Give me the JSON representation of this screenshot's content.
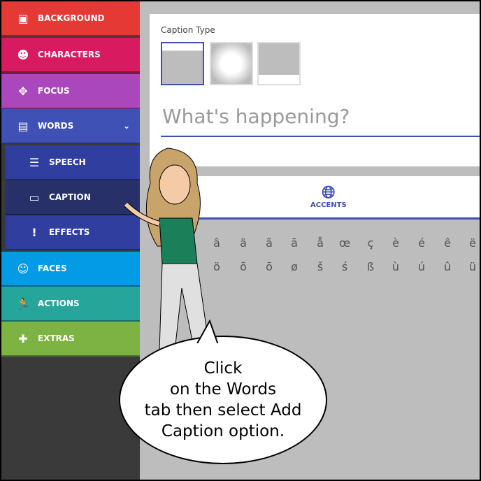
{
  "sidebar": {
    "items": [
      {
        "label": "BACKGROUND",
        "icon": "image-icon",
        "color": "#e53935"
      },
      {
        "label": "CHARACTERS",
        "icon": "face-icon",
        "color": "#d81b60"
      },
      {
        "label": "FOCUS",
        "icon": "move-icon",
        "color": "#ab47bc"
      },
      {
        "label": "WORDS",
        "icon": "message-icon",
        "color": "#3f51b5"
      },
      {
        "label": "SPEECH",
        "icon": "list-icon",
        "color": "#303f9f"
      },
      {
        "label": "CAPTION",
        "icon": "window-icon",
        "color": "#283069"
      },
      {
        "label": "EFFECTS",
        "icon": "exclamation-icon",
        "color": "#303f9f"
      },
      {
        "label": "FACES",
        "icon": "smile-icon",
        "color": "#039be5"
      },
      {
        "label": "ACTIONS",
        "icon": "run-icon",
        "color": "#26a69a"
      },
      {
        "label": "EXTRAS",
        "icon": "puzzle-icon",
        "color": "#7cb342"
      }
    ]
  },
  "caption_panel": {
    "title": "Caption Type",
    "placeholder": "What's happening?"
  },
  "tabs": {
    "accents": "ACCENTS"
  },
  "accents": {
    "row1": [
      "â",
      "ä",
      "ã",
      "ā",
      "å",
      "œ",
      "ç",
      "è",
      "é",
      "ê",
      "ë"
    ],
    "row2": [
      "ö",
      "õ",
      "ō",
      "ø",
      "š",
      "ś",
      "ß",
      "ù",
      "ú",
      "û",
      "ü"
    ]
  },
  "bubble": {
    "lines": [
      "Click",
      "on the Words",
      "tab then select Add",
      "Caption option."
    ]
  }
}
